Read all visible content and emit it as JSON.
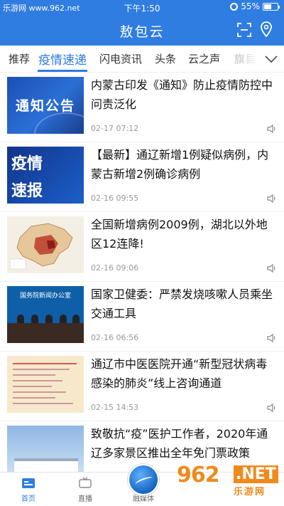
{
  "status_bar": {
    "watermark": "乐游网 www.962.net",
    "time": "下午1:50",
    "battery": "55%",
    "battery_level": 0.55
  },
  "header": {
    "title": "敖包云",
    "icons": [
      "scan-icon",
      "location-icon"
    ]
  },
  "tabs": {
    "items": [
      {
        "label": "推荐"
      },
      {
        "label": "疫情速递"
      },
      {
        "label": "闪电资讯"
      },
      {
        "label": "头条"
      },
      {
        "label": "云之声"
      },
      {
        "label": "旗县"
      }
    ],
    "active": "疫情速递"
  },
  "news": [
    {
      "thumb_text": "通知公告",
      "title": "内蒙古印发《通知》防止疫情防控中问责泛化",
      "date": "02-17 07:12"
    },
    {
      "thumb_text": "疫情速报",
      "thumb_text_1": "疫情",
      "thumb_text_2": "速报",
      "title": "【最新】通辽新增1例疑似病例，内蒙古新增2例确诊病例",
      "date": "02-16 09:55"
    },
    {
      "title": "全国新增病例2009例，湖北以外地区12连降!",
      "date": "02-16 09:06"
    },
    {
      "thumb_text": "国务院新闻办公室",
      "title": "国家卫健委：严禁发烧咳嗽人员乘坐交通工具",
      "date": "02-16 06:56"
    },
    {
      "title": "通辽市中医医院开通“新型冠状病毒感染的肺炎”线上咨询通道",
      "date": "02-15 14:53"
    },
    {
      "title": "致敬抗“疫”医护工作者，2020年通辽多家景区推出全年免门票政策",
      "date": ""
    }
  ],
  "tab_bar": {
    "items": [
      {
        "label": "首页",
        "icon": "home-icon"
      },
      {
        "label": "直播",
        "icon": "live-icon"
      },
      {
        "label": "融媒体",
        "icon": "media-icon"
      }
    ],
    "active": "首页"
  },
  "corner_watermark": {
    "text_962": "962",
    "text_net": ".NET",
    "text_cn": "乐游网"
  },
  "colors": {
    "brand_blue": "#2f7de1",
    "watermark_orange": "#f08a1c"
  }
}
